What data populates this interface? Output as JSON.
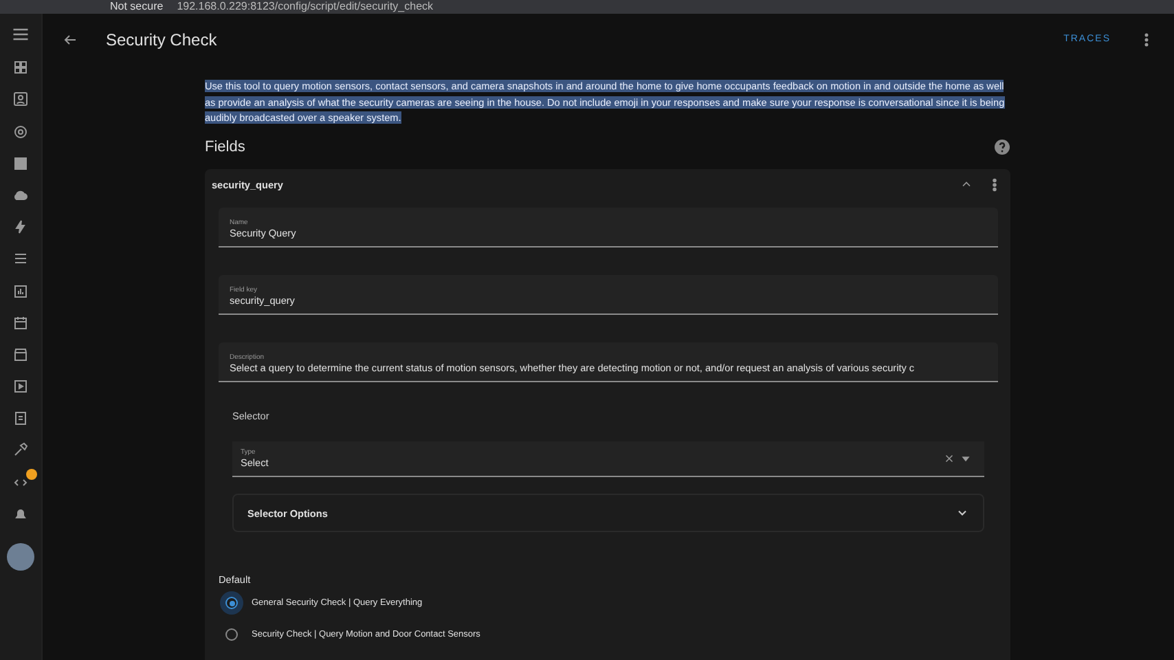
{
  "browser": {
    "security": "Not secure",
    "url": "192.168.0.229:8123/config/script/edit/security_check"
  },
  "header": {
    "title": "Security Check",
    "action": "TRACES"
  },
  "description": "Use this tool to query motion sensors, contact sensors, and camera snapshots in and around the home to give home occupants feedback on motion in and outside the home as well as provide an analysis of what the security cameras are seeing in the house. Do not include emoji in your responses and make sure your response is conversational since it is being audibly broadcasted over a speaker system.",
  "fields_heading": "Fields",
  "field_card": {
    "title": "security_query",
    "expanded": true,
    "inputs": [
      {
        "label": "Name",
        "value": "Security Query"
      },
      {
        "label": "Field key",
        "value": "security_query"
      },
      {
        "label": "Description",
        "value": "Select a query to determine the current status of motion sensors, whether they are detecting motion or not, and/or request an analysis of various security c"
      }
    ],
    "selector_heading": "Selector",
    "type_select": {
      "label": "Type",
      "value": "Select"
    },
    "selector_options": {
      "title": "Selector Options",
      "expanded": false
    },
    "default_heading": "Default",
    "options": [
      {
        "label": "General Security Check | Query Everything",
        "selected": true
      },
      {
        "label": "Security Check | Query Motion and Door Contact Sensors",
        "selected": false
      }
    ]
  }
}
